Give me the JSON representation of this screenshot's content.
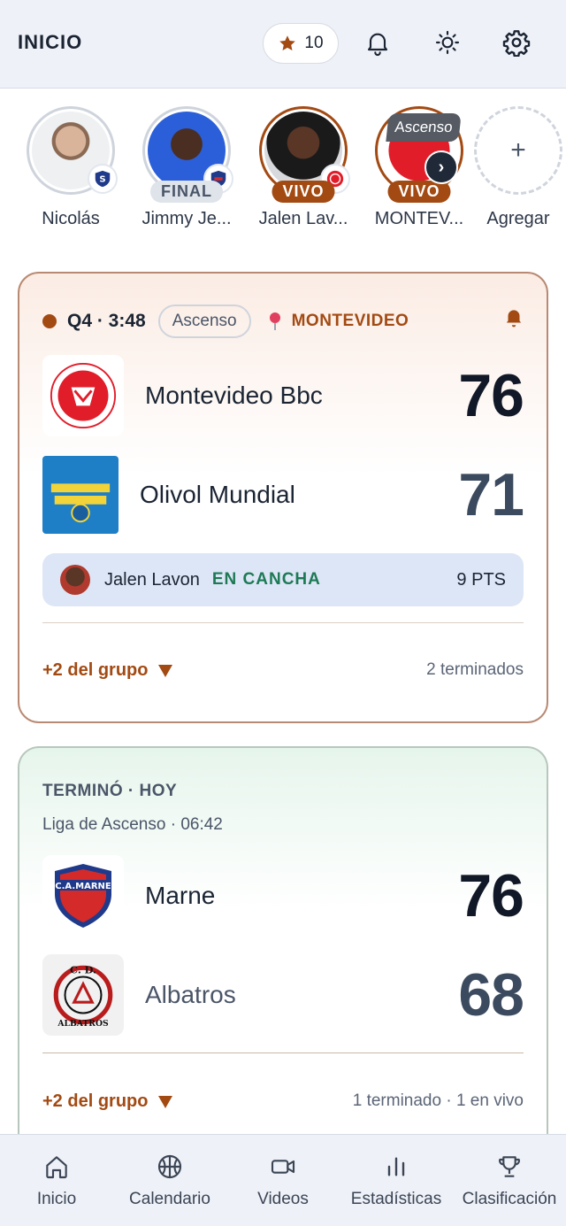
{
  "header": {
    "title": "INICIO",
    "favorites_count": "10"
  },
  "stories": [
    {
      "name": "Nicolás",
      "status": ""
    },
    {
      "name": "Jimmy Je...",
      "status": "FINAL"
    },
    {
      "name": "Jalen Lav...",
      "status": "VIVO"
    },
    {
      "name": "MONTEV...",
      "status": "VIVO",
      "overlay": "Ascenso"
    },
    {
      "name": "Agregar",
      "status": ""
    }
  ],
  "live_game": {
    "dot_color": "#a34a13",
    "clock": "Q4 · 3:48",
    "league": "Ascenso",
    "venue": "MONTEVIDEO",
    "home": {
      "name": "Montevideo Bbc",
      "score": "76"
    },
    "away": {
      "name": "Olivol Mundial",
      "score": "71"
    },
    "player": {
      "name": "Jalen Lavon",
      "state": "EN CANCHA",
      "points": "9 PTS"
    },
    "group_toggle": "+2 del grupo",
    "group_status": "2 terminados"
  },
  "finished_game": {
    "title": "TERMINÓ · HOY",
    "subtitle": "Liga de Ascenso · 06:42",
    "home": {
      "name": "Marne",
      "score": "76"
    },
    "away": {
      "name": "Albatros",
      "score": "68"
    },
    "group_toggle": "+2 del grupo",
    "group_status": "1 terminado · 1 en vivo"
  },
  "nav": [
    {
      "label": "Inicio",
      "icon": "home-icon"
    },
    {
      "label": "Calendario",
      "icon": "basketball-icon"
    },
    {
      "label": "Videos",
      "icon": "video-icon"
    },
    {
      "label": "Estadísticas",
      "icon": "bar-chart-icon"
    },
    {
      "label": "Clasificación",
      "icon": "trophy-icon"
    }
  ],
  "colors": {
    "accent": "#a34a13",
    "live_green": "#1d7a55",
    "header_bg": "#eef1f7"
  }
}
